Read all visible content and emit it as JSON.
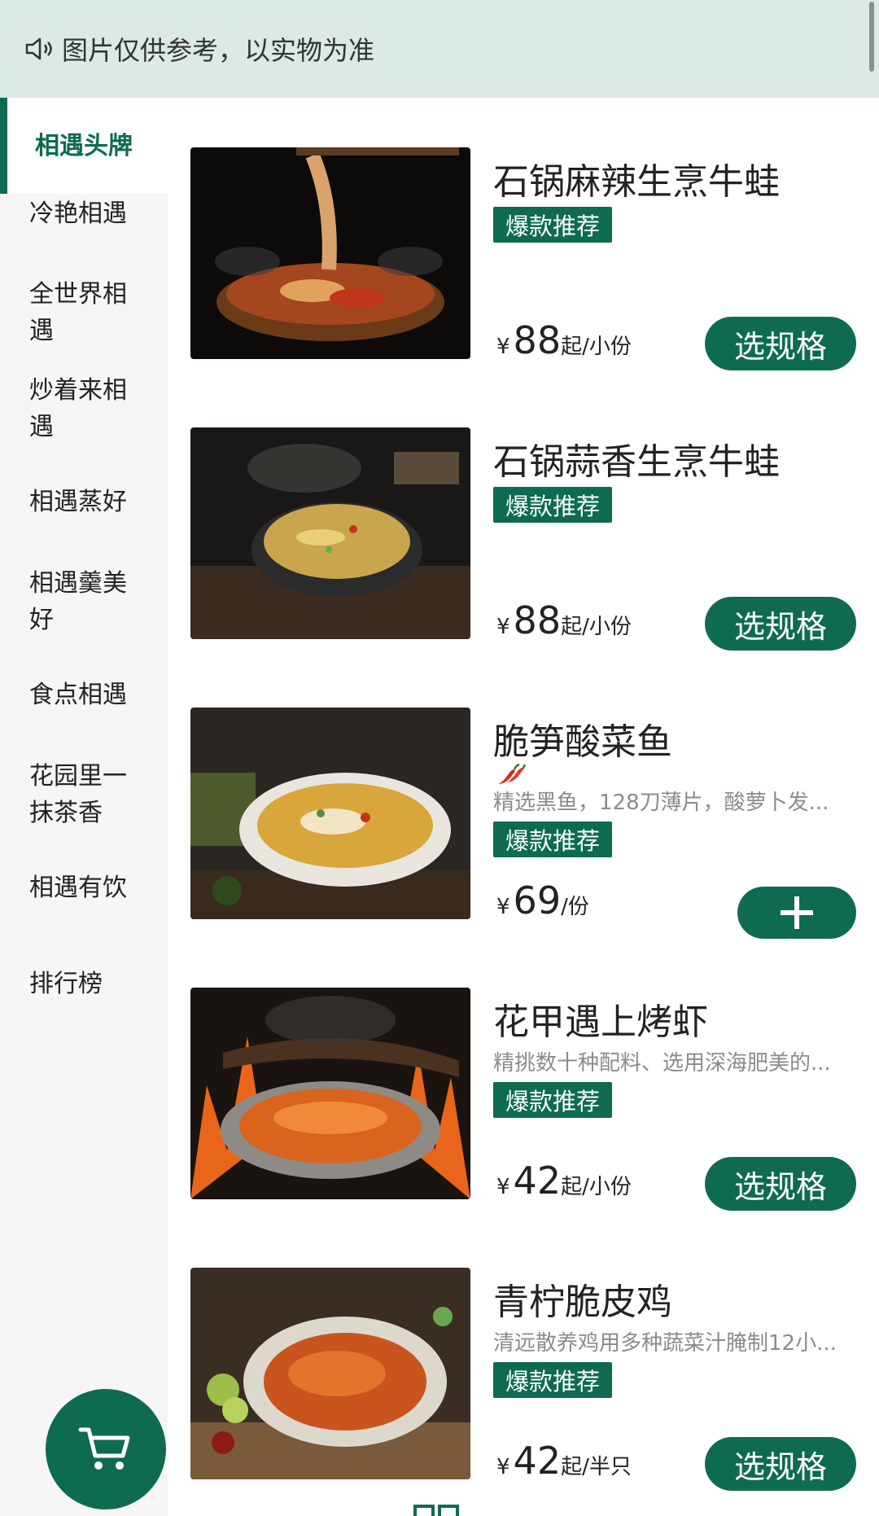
{
  "notice": {
    "text": "图片仅供参考，以实物为准",
    "icon": "speaker-icon"
  },
  "sidebar": {
    "items": [
      {
        "label": "相遇头牌",
        "active": true
      },
      {
        "label": "冷艳相遇"
      },
      {
        "label": "全世界相遇"
      },
      {
        "label": "炒着来相遇"
      },
      {
        "label": "相遇蒸好"
      },
      {
        "label": "相遇羹美好"
      },
      {
        "label": "食点相遇"
      },
      {
        "label": "花园里一抹茶香"
      },
      {
        "label": "相遇有饮"
      },
      {
        "label": "排行榜"
      }
    ]
  },
  "dishes": [
    {
      "title": "石锅麻辣生烹牛蛙",
      "badge": "爆款推荐",
      "currency": "¥",
      "price": "88",
      "unit": "起/小份",
      "action": "选规格"
    },
    {
      "title": "石锅蒜香生烹牛蛙",
      "badge": "爆款推荐",
      "currency": "¥",
      "price": "88",
      "unit": "起/小份",
      "action": "选规格"
    },
    {
      "title": "脆笋酸菜鱼",
      "spicy_icon": "chili-icon",
      "desc": "精选黑鱼，128刀薄片，酸萝卜发...",
      "badge": "爆款推荐",
      "currency": "¥",
      "price": "69",
      "unit": "/份",
      "action_icon": "plus-icon"
    },
    {
      "title": "花甲遇上烤虾",
      "desc": "精挑数十种配料、选用深海肥美的...",
      "badge": "爆款推荐",
      "currency": "¥",
      "price": "42",
      "unit": "起/小份",
      "action": "选规格"
    },
    {
      "title": "青柠脆皮鸡",
      "desc": "清远散养鸡用多种蔬菜汁腌制12小...",
      "badge": "爆款推荐",
      "currency": "¥",
      "price": "42",
      "unit": "起/半只",
      "action": "选规格"
    }
  ],
  "cart": {
    "icon": "cart-icon"
  },
  "colors": {
    "accent": "#0e6b52",
    "notice_bg": "#dce9e5",
    "sidebar_bg": "#f6f6f6"
  }
}
